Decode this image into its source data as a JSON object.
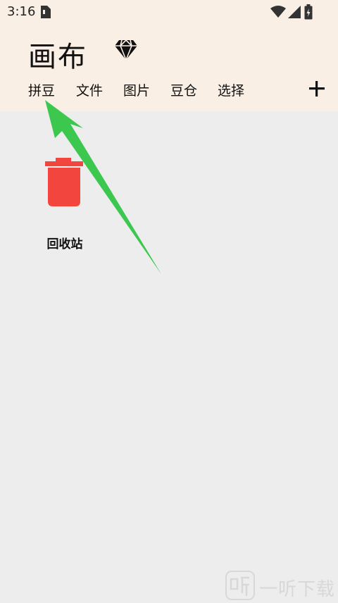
{
  "status_bar": {
    "time": "3:16",
    "icons": [
      "sim-icon",
      "wifi-icon",
      "signal-icon",
      "battery-icon"
    ]
  },
  "header": {
    "title": "画布",
    "vip_icon": "gem-icon",
    "tabs": [
      {
        "label": "拼豆"
      },
      {
        "label": "文件"
      },
      {
        "label": "图片"
      },
      {
        "label": "豆仓"
      },
      {
        "label": "选择"
      }
    ],
    "add_icon": "plus-icon"
  },
  "content": {
    "items": [
      {
        "label": "回收站",
        "icon": "trash-icon"
      }
    ]
  },
  "watermark": {
    "logo_icon": "ting-logo-icon",
    "text": "一听下载"
  },
  "colors": {
    "header_bg": "#faefe5",
    "content_bg": "#ededed",
    "trash_red": "#f1453d",
    "arrow_green": "#3cc74f"
  }
}
